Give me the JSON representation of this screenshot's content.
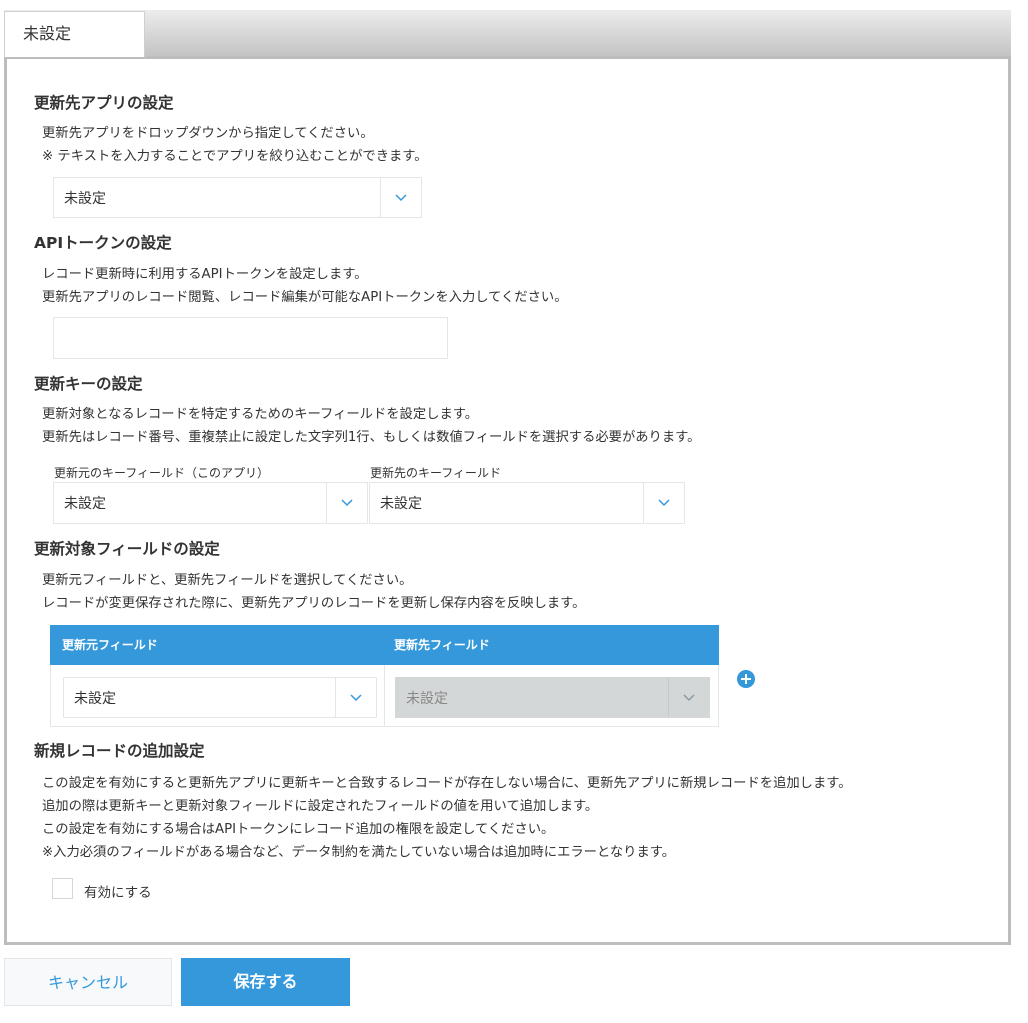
{
  "tab": {
    "label": "未設定"
  },
  "app_section": {
    "title": "更新先アプリの設定",
    "desc1": "更新先アプリをドロップダウンから指定してください。",
    "desc2": "※ テキストを入力することでアプリを絞り込むことができます。",
    "select_value": "未設定"
  },
  "token_section": {
    "title": "APIトークンの設定",
    "desc1": "レコード更新時に利用するAPIトークンを設定します。",
    "desc2": "更新先アプリのレコード閲覧、レコード編集が可能なAPIトークンを入力してください。",
    "input_value": ""
  },
  "key_section": {
    "title": "更新キーの設定",
    "desc1": "更新対象となるレコードを特定するためのキーフィールドを設定します。",
    "desc2": "更新先はレコード番号、重複禁止に設定した文字列1行、もしくは数値フィールドを選択する必要があります。",
    "source_label": "更新元のキーフィールド（このアプリ）",
    "target_label": "更新先のキーフィールド",
    "source_value": "未設定",
    "target_value": "未設定"
  },
  "fields_section": {
    "title": "更新対象フィールドの設定",
    "desc1": "更新元フィールドと、更新先フィールドを選択してください。",
    "desc2": "レコードが変更保存された際に、更新先アプリのレコードを更新し保存内容を反映します。",
    "col_source": "更新元フィールド",
    "col_target": "更新先フィールド",
    "row_source_value": "未設定",
    "row_target_value": "未設定"
  },
  "add_section": {
    "title": "新規レコードの追加設定",
    "desc1": "この設定を有効にすると更新先アプリに更新キーと合致するレコードが存在しない場合に、更新先アプリに新規レコードを追加します。",
    "desc2": "追加の際は更新キーと更新対象フィールドに設定されたフィールドの値を用いて追加します。",
    "desc3": "この設定を有効にする場合はAPIトークンにレコード追加の権限を設定してください。",
    "desc4": "※入力必須のフィールドがある場合など、データ制約を満たしていない場合は追加時にエラーとなります。",
    "checkbox_label": "有効にする",
    "checkbox_checked": false
  },
  "buttons": {
    "cancel": "キャンセル",
    "save": "保存する"
  },
  "colors": {
    "accent": "#3498db",
    "border": "#e3e7e8",
    "disabled": "#d4d7d7"
  }
}
